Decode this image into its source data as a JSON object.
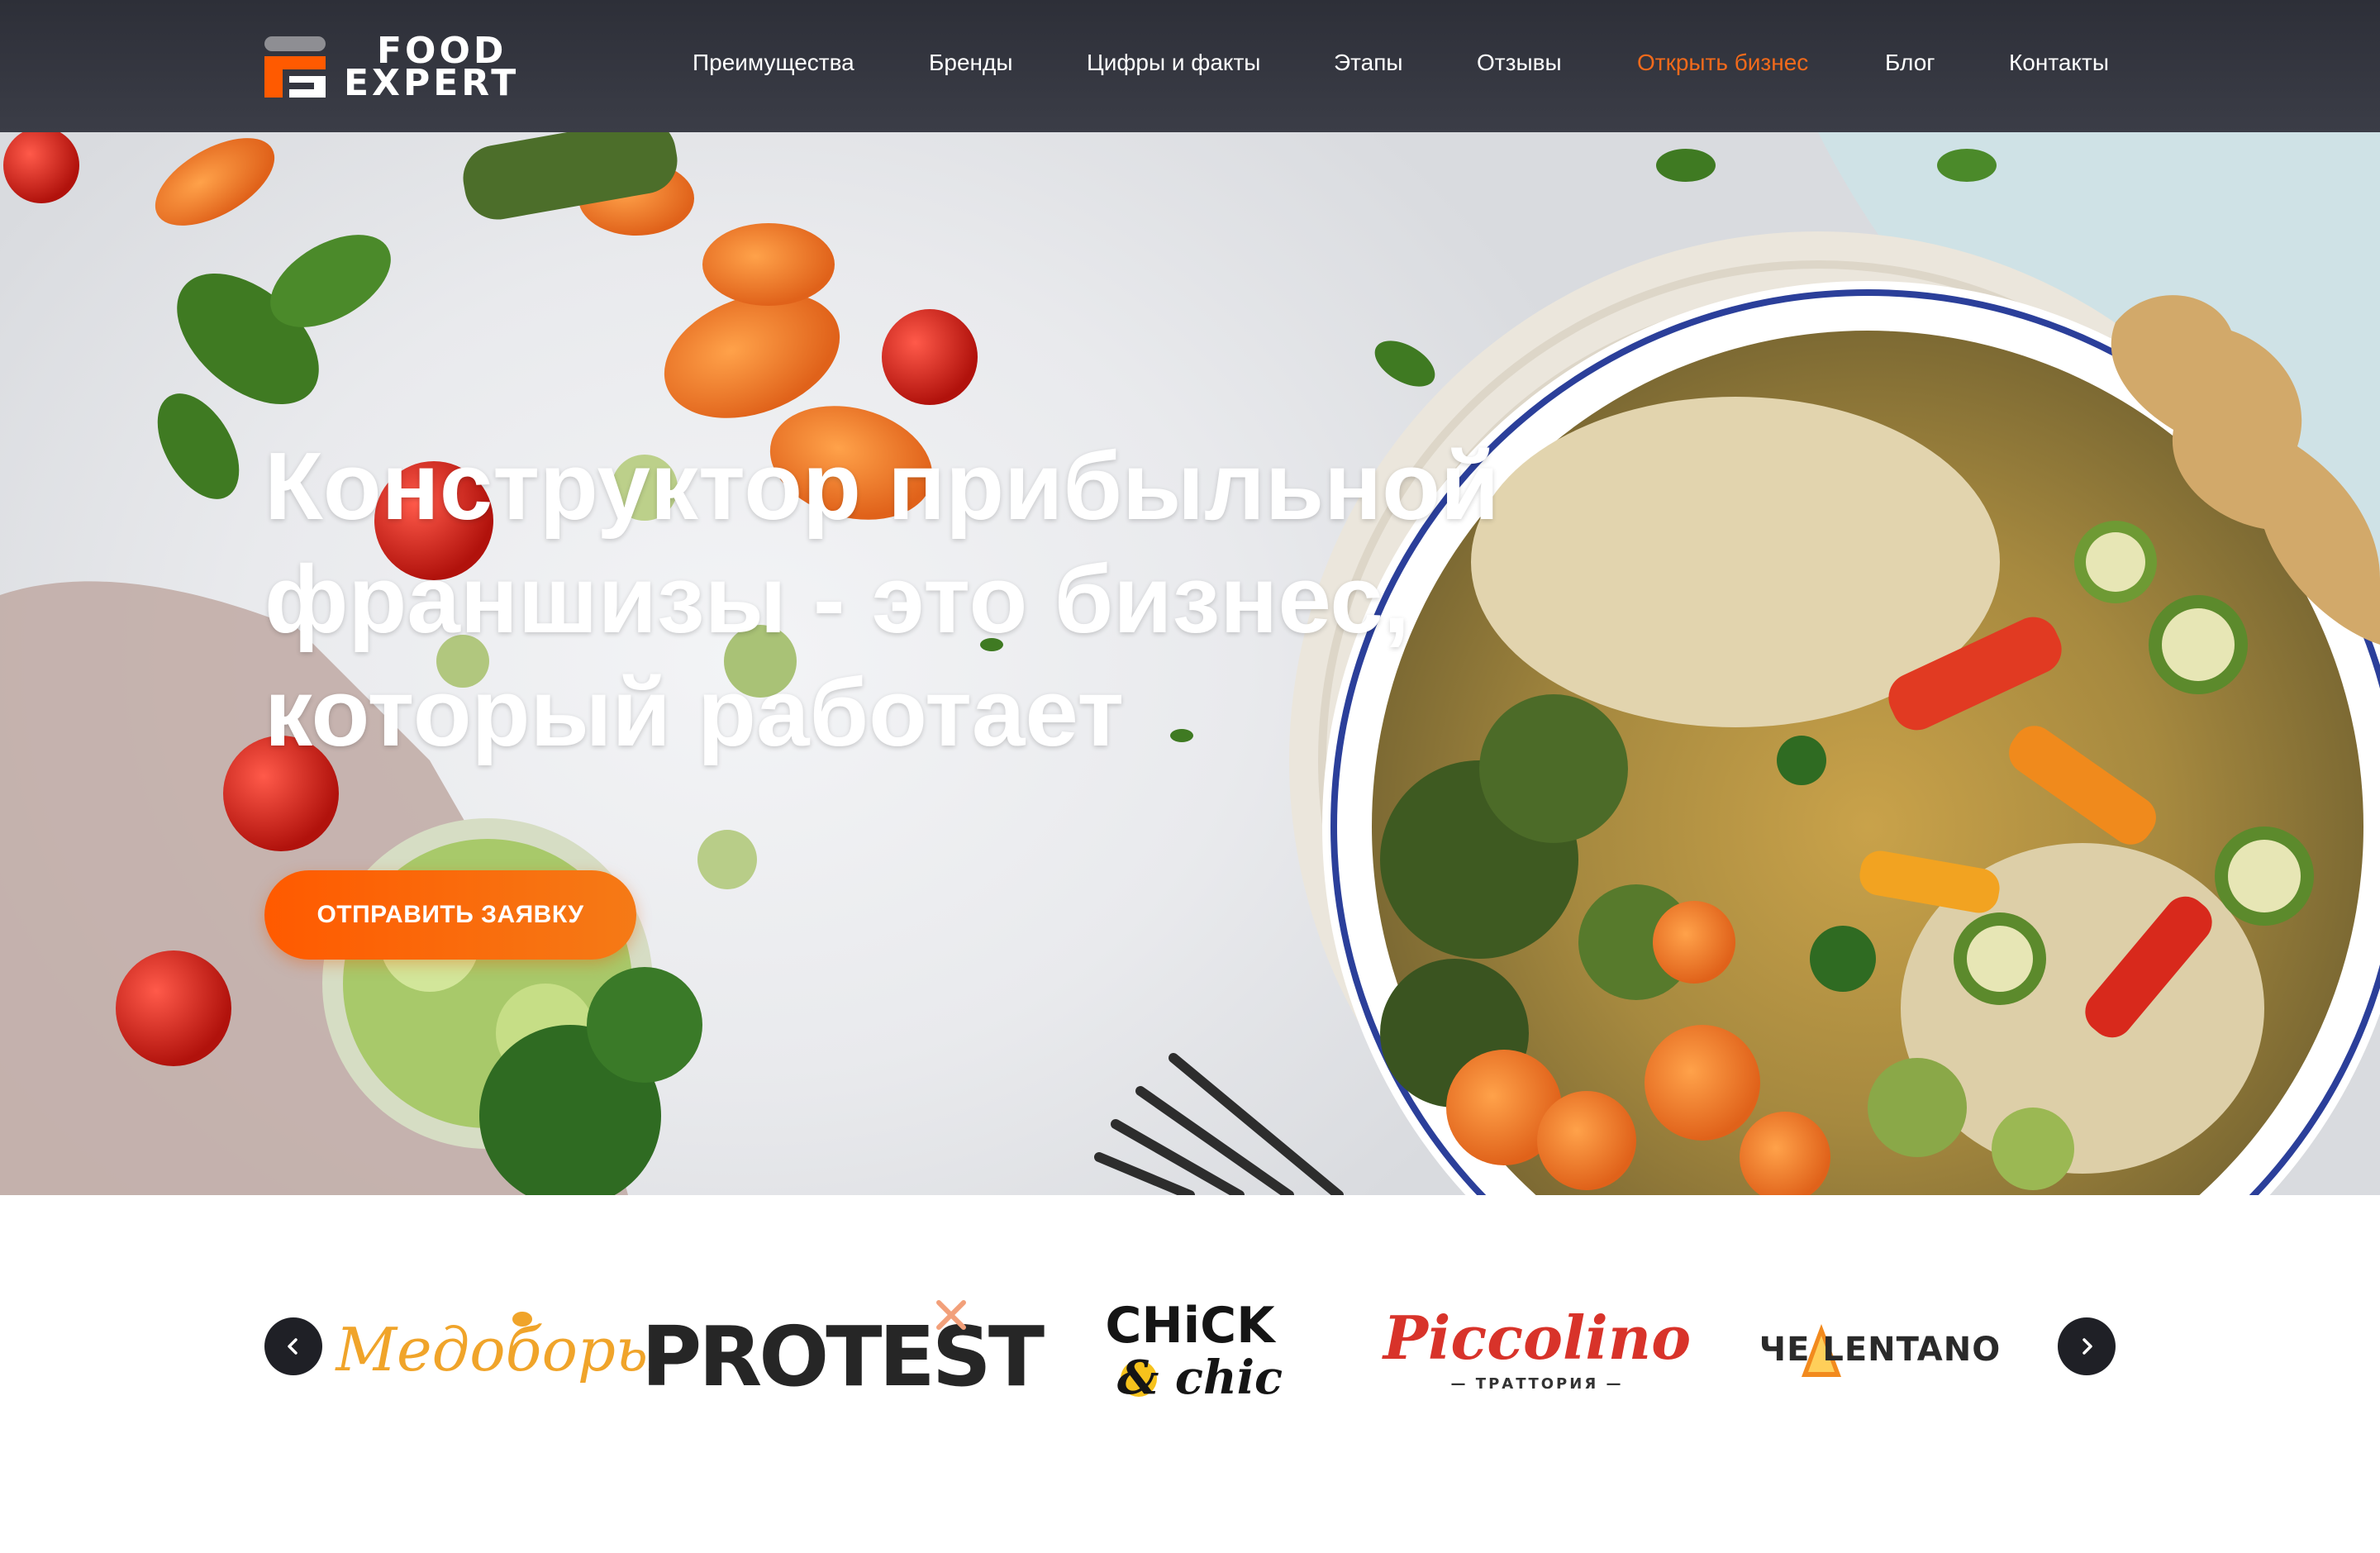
{
  "header": {
    "logo": {
      "line1": "FOOD",
      "line2": "EXPERT"
    },
    "nav": [
      {
        "label": "Преимущества",
        "active": false
      },
      {
        "label": "Бренды",
        "active": false
      },
      {
        "label": "Цифры и факты",
        "active": false
      },
      {
        "label": "Этапы",
        "active": false
      },
      {
        "label": "Отзывы",
        "active": false
      },
      {
        "label": "Открыть бизнес",
        "active": true
      },
      {
        "label": "Блог",
        "active": false
      },
      {
        "label": "Контакты",
        "active": false
      }
    ]
  },
  "hero": {
    "title_lines": [
      "Конструктор прибыльной",
      "франшизы - это бизнес,",
      "который работает"
    ],
    "cta_label": "ОТПРАВИТЬ ЗАЯВКУ"
  },
  "brands": {
    "prev_icon": "chevron-left-icon",
    "next_icon": "chevron-right-icon",
    "items": [
      {
        "name": "Медоборы"
      },
      {
        "name": "PROTEST"
      },
      {
        "name_line1": "CHiCK",
        "name_line2": "& chic"
      },
      {
        "name": "Piccolino",
        "subtitle": "— ТРАТТОРИЯ —"
      },
      {
        "name": "ЧЕ LENTANO"
      }
    ]
  },
  "colors": {
    "header_bg": "#33353f",
    "accent_orange": "#f26a1b",
    "cta_gradient_start": "#ff5a00",
    "cta_gradient_end": "#f57a16",
    "arrow_bg": "#1f2026"
  }
}
